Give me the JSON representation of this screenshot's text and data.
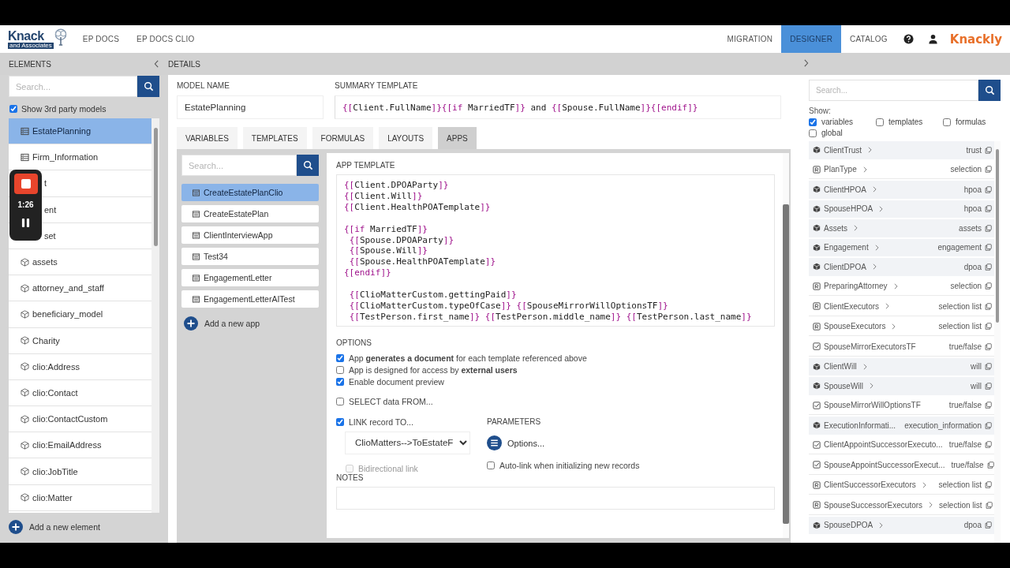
{
  "header": {
    "logo": {
      "name": "Knack",
      "subtitle": "and Associates"
    },
    "nav_left": [
      {
        "label": "EP DOCS",
        "selected": false
      },
      {
        "label": "EP DOCS CLIO",
        "selected": false
      }
    ],
    "nav_right": [
      {
        "label": "MIGRATION",
        "selected": false
      },
      {
        "label": "DESIGNER",
        "selected": true
      },
      {
        "label": "CATALOG",
        "selected": false
      }
    ],
    "brand": "Knackly"
  },
  "elements_panel": {
    "title": "ELEMENTS",
    "search": {
      "placeholder": "Search..."
    },
    "show_3rd_party": {
      "label": "Show 3rd party models",
      "checked": true
    },
    "items": [
      {
        "kind": "model",
        "label": "EstatePlanning",
        "selected": true
      },
      {
        "kind": "model",
        "label": "Firm_Information",
        "selected": false
      },
      {
        "kind": "covered",
        "label": "t",
        "selected": false
      },
      {
        "kind": "covered",
        "label": "ent",
        "selected": false
      },
      {
        "kind": "covered",
        "label": "set",
        "selected": false
      },
      {
        "kind": "cube",
        "label": "assets",
        "selected": false
      },
      {
        "kind": "cube",
        "label": "attorney_and_staff",
        "selected": false
      },
      {
        "kind": "cube",
        "label": "beneficiary_model",
        "selected": false
      },
      {
        "kind": "cube",
        "label": "Charity",
        "selected": false
      },
      {
        "kind": "cube",
        "label": "clio:Address",
        "selected": false
      },
      {
        "kind": "cube",
        "label": "clio:Contact",
        "selected": false
      },
      {
        "kind": "cube",
        "label": "clio:ContactCustom",
        "selected": false
      },
      {
        "kind": "cube",
        "label": "clio:EmailAddress",
        "selected": false
      },
      {
        "kind": "cube",
        "label": "clio:JobTitle",
        "selected": false
      },
      {
        "kind": "cube",
        "label": "clio:Matter",
        "selected": false
      }
    ],
    "add": "Add a new element"
  },
  "recorder": {
    "time": "1:26"
  },
  "details": {
    "title": "DETAILS",
    "model_name": {
      "label": "MODEL NAME",
      "value": "EstatePlanning"
    },
    "summary_template": {
      "label": "SUMMARY TEMPLATE",
      "value": "{[Client.FullName]}{[if MarriedTF]} and {[Spouse.FullName]}{[endif]}"
    },
    "tabs": [
      {
        "label": "VARIABLES",
        "selected": false
      },
      {
        "label": "TEMPLATES",
        "selected": false
      },
      {
        "label": "FORMULAS",
        "selected": false
      },
      {
        "label": "LAYOUTS",
        "selected": false
      },
      {
        "label": "APPS",
        "selected": true
      }
    ],
    "apps": {
      "search": {
        "placeholder": "Search..."
      },
      "items": [
        {
          "label": "CreateEstatePlanClio",
          "selected": true
        },
        {
          "label": "CreateEstatePlan",
          "selected": false
        },
        {
          "label": "ClientInterviewApp",
          "selected": false
        },
        {
          "label": "Test34",
          "selected": false
        },
        {
          "label": "EngagementLetter",
          "selected": false
        },
        {
          "label": "EngagementLetterAITest",
          "selected": false
        }
      ],
      "add": "Add a new app"
    },
    "app_template": {
      "label": "APP TEMPLATE",
      "blocks": [
        [
          "{[Client.DPOAParty]}",
          "{[Client.Will]}",
          "{[Client.HealthPOATemplate]}"
        ],
        [
          "{[if MarriedTF]}",
          " {[Spouse.DPOAParty]}",
          " {[Spouse.Will]}",
          " {[Spouse.HealthPOATemplate]}",
          "{[endif]}"
        ],
        [
          " {[ClioMatterCustom.gettingPaid]}",
          " {[ClioMatterCustom.typeOfCase]} {[SpouseMirrorWillOptionsTF]}",
          " {[TestPerson.first_name]} {[TestPerson.middle_name]} {[TestPerson.last_name]}"
        ]
      ]
    },
    "options": {
      "label": "OPTIONS",
      "items": [
        {
          "text": "App **generates a document** for each template referenced above",
          "checked": true
        },
        {
          "text": "App is designed for access by **external users**",
          "checked": false
        },
        {
          "text": "Enable document preview",
          "checked": true
        }
      ]
    },
    "select_data": {
      "label": "SELECT data FROM...",
      "checked": false
    },
    "link": {
      "label": "LINK record TO...",
      "checked": true,
      "value": "ClioMatters-->ToEstateF",
      "bidirectional": {
        "label": "Bidirectional link",
        "checked": false,
        "disabled": true
      }
    },
    "parameters": {
      "label": "PARAMETERS",
      "button": "Options...",
      "autolink": {
        "label": "Auto-link when initializing new records",
        "checked": false
      }
    },
    "notes": {
      "label": "NOTES"
    }
  },
  "variables_panel": {
    "search": {
      "placeholder": "Search..."
    },
    "show_label": "Show:",
    "filters": [
      {
        "label": "variables",
        "checked": true
      },
      {
        "label": "templates",
        "checked": false
      },
      {
        "label": "formulas",
        "checked": false
      },
      {
        "label": "global",
        "checked": false
      }
    ],
    "items": [
      {
        "kind": "object",
        "name": "ClientTrust",
        "expandable": true,
        "type": "trust"
      },
      {
        "kind": "selection",
        "name": "PlanType",
        "expandable": true,
        "type": "selection"
      },
      {
        "kind": "object",
        "name": "ClientHPOA",
        "expandable": true,
        "type": "hpoa"
      },
      {
        "kind": "object",
        "name": "SpouseHPOA",
        "expandable": true,
        "type": "hpoa"
      },
      {
        "kind": "object",
        "name": "Assets",
        "expandable": true,
        "type": "assets"
      },
      {
        "kind": "object",
        "name": "Engagement",
        "expandable": true,
        "type": "engagement"
      },
      {
        "kind": "object",
        "name": "ClientDPOA",
        "expandable": true,
        "type": "dpoa"
      },
      {
        "kind": "selection",
        "name": "PreparingAttorney",
        "expandable": true,
        "type": "selection"
      },
      {
        "kind": "selection",
        "name": "ClientExecutors",
        "expandable": true,
        "type": "selection list"
      },
      {
        "kind": "selection",
        "name": "SpouseExecutors",
        "expandable": true,
        "type": "selection list"
      },
      {
        "kind": "truefalse",
        "name": "SpouseMirrorExecutorsTF",
        "expandable": false,
        "type": "true/false"
      },
      {
        "kind": "object",
        "name": "ClientWill",
        "expandable": true,
        "type": "will"
      },
      {
        "kind": "object",
        "name": "SpouseWill",
        "expandable": true,
        "type": "will"
      },
      {
        "kind": "truefalse",
        "name": "SpouseMirrorWillOptionsTF",
        "expandable": false,
        "type": "true/false"
      },
      {
        "kind": "object",
        "name": "ExecutionInformati...",
        "expandable": false,
        "type": "execution_information"
      },
      {
        "kind": "truefalse",
        "name": "ClientAppointSuccessorExecuto...",
        "expandable": false,
        "type": "true/false"
      },
      {
        "kind": "truefalse",
        "name": "SpouseAppointSuccessorExecut...",
        "expandable": false,
        "type": "true/false"
      },
      {
        "kind": "selection",
        "name": "ClientSuccessorExecutors",
        "expandable": true,
        "type": "selection list"
      },
      {
        "kind": "selection",
        "name": "SpouseSuccessorExecutors",
        "expandable": true,
        "type": "selection list"
      },
      {
        "kind": "object",
        "name": "SpouseDPOA",
        "expandable": true,
        "type": "dpoa"
      }
    ]
  }
}
